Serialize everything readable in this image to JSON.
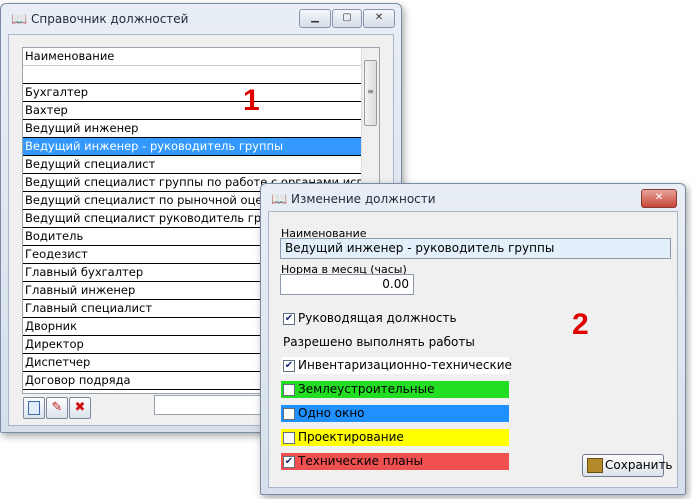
{
  "window1": {
    "title": "Справочник должностей",
    "controls": {
      "minimize": "▁",
      "maximize": "▢",
      "close": "✕"
    },
    "list": {
      "header": "Наименование",
      "rows": [
        {
          "text": "",
          "selected": false
        },
        {
          "text": "Бухгалтер",
          "selected": false
        },
        {
          "text": "Вахтер",
          "selected": false
        },
        {
          "text": "Ведущий инженер",
          "selected": false
        },
        {
          "text": "Ведущий инженер - руководитель группы",
          "selected": true
        },
        {
          "text": "Ведущий специалист",
          "selected": false
        },
        {
          "text": "Ведущий специалист группы по работе с органами исполн",
          "selected": false
        },
        {
          "text": "Ведущий специалист по рыночной оценке",
          "selected": false
        },
        {
          "text": "Ведущий специалист руководитель группы",
          "selected": false
        },
        {
          "text": "Водитель",
          "selected": false
        },
        {
          "text": "Геодезист",
          "selected": false
        },
        {
          "text": "Главный бухгалтер",
          "selected": false
        },
        {
          "text": "Главный инженер",
          "selected": false
        },
        {
          "text": "Главный специалист",
          "selected": false
        },
        {
          "text": "Дворник",
          "selected": false
        },
        {
          "text": "Директор",
          "selected": false
        },
        {
          "text": "Диспетчер",
          "selected": false
        },
        {
          "text": "Договор подряда",
          "selected": false
        }
      ],
      "scroll_grip": "≡"
    },
    "toolbar": {
      "new_icon": "document-icon",
      "edit_icon": "pencil-icon",
      "delete_icon": "delete-x-icon"
    },
    "annotation": "1"
  },
  "window2": {
    "title": "Изменение должности",
    "close": "✕",
    "name_label": "Наименование",
    "name_value": "Ведущий инженер - руководитель группы",
    "norm_label": "Норма в месяц (часы)",
    "norm_value": "0.00",
    "manager_label": "Руководящая должность",
    "manager_checked": true,
    "allowed_label": "Разрешено выполнять работы",
    "works": [
      {
        "label": "Инвентаризационно-технические",
        "checked": true,
        "color": "#ffffff"
      },
      {
        "label": "Землеустроительные",
        "checked": false,
        "color": "#22dd22"
      },
      {
        "label": "Одно окно",
        "checked": false,
        "color": "#1e90ff"
      },
      {
        "label": "Проектирование",
        "checked": false,
        "color": "#ffff00"
      },
      {
        "label": "Технические планы",
        "checked": true,
        "color": "#f05050"
      }
    ],
    "save_label": "Сохранить",
    "annotation": "2"
  }
}
